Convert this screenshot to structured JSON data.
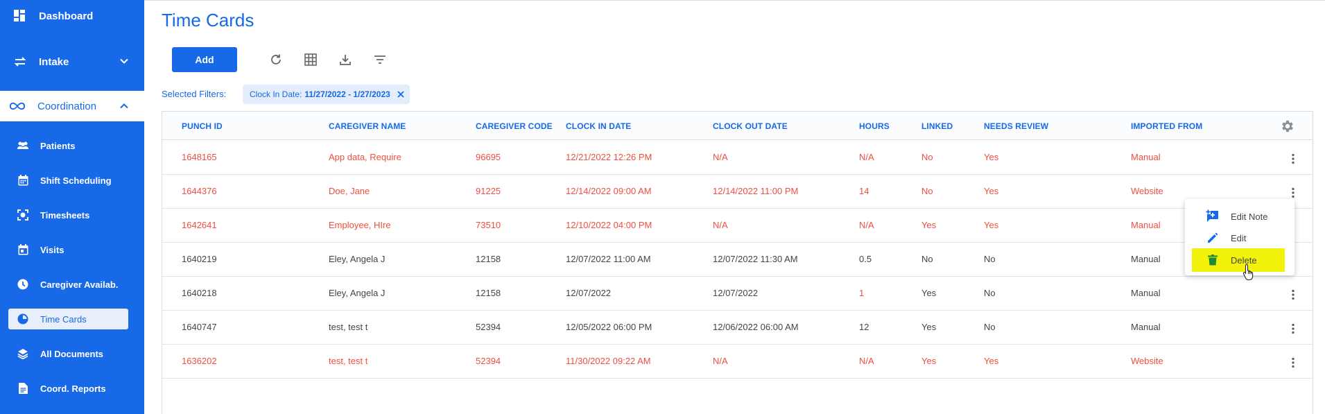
{
  "sidebar": {
    "dashboard": "Dashboard",
    "intake": "Intake",
    "coordination": "Coordination",
    "items": [
      {
        "label": "Patients",
        "icon": "people-icon"
      },
      {
        "label": "Shift Scheduling",
        "icon": "calendar-icon"
      },
      {
        "label": "Timesheets",
        "icon": "scan-icon"
      },
      {
        "label": "Visits",
        "icon": "calendar-check-icon"
      },
      {
        "label": "Caregiver Availab.",
        "icon": "clock-icon"
      },
      {
        "label": "Time Cards",
        "icon": "timer-icon",
        "active": true
      },
      {
        "label": "All Documents",
        "icon": "layers-icon"
      },
      {
        "label": "Coord. Reports",
        "icon": "document-icon"
      }
    ]
  },
  "page": {
    "title": "Time Cards",
    "add_label": "Add",
    "filters_label": "Selected Filters:",
    "filter_chip": {
      "key": "Clock In Date:",
      "value": "11/27/2022 - 1/27/2023"
    }
  },
  "table": {
    "columns": [
      "PUNCH ID",
      "CAREGIVER NAME",
      "CAREGIVER CODE",
      "CLOCK IN DATE",
      "CLOCK OUT DATE",
      "HOURS",
      "LINKED",
      "NEEDS REVIEW",
      "IMPORTED FROM"
    ],
    "rows": [
      {
        "id": "1648165",
        "name": "App data, Require",
        "code": "96695",
        "in": "12/21/2022 12:26 PM",
        "out": "N/A",
        "hours": "N/A",
        "linked": "No",
        "review": "Yes",
        "source": "Manual",
        "flag": true
      },
      {
        "id": "1644376",
        "name": "Doe, Jane",
        "code": "91225",
        "in": "12/14/2022 09:00 AM",
        "out": "12/14/2022 11:00 PM",
        "hours": "14",
        "linked": "No",
        "review": "Yes",
        "source": "Website",
        "flag": true
      },
      {
        "id": "1642641",
        "name": "Employee, HIre",
        "code": "73510",
        "in": "12/10/2022 04:00 PM",
        "out": "N/A",
        "hours": "N/A",
        "linked": "Yes",
        "review": "Yes",
        "source": "Manual",
        "flag": true
      },
      {
        "id": "1640219",
        "name": "Eley, Angela J",
        "code": "12158",
        "in": "12/07/2022 11:00 AM",
        "out": "12/07/2022 11:30 AM",
        "hours": "0.5",
        "linked": "No",
        "review": "No",
        "source": "Manual",
        "flag": false
      },
      {
        "id": "1640218",
        "name": "Eley, Angela J",
        "code": "12158",
        "in": "12/07/2022",
        "out": "12/07/2022",
        "hours": "1",
        "linked": "Yes",
        "review": "No",
        "source": "Manual",
        "flag": false,
        "hours_flag": true
      },
      {
        "id": "1640747",
        "name": "test, test t",
        "code": "52394",
        "in": "12/05/2022 06:00 PM",
        "out": "12/06/2022 06:00 AM",
        "hours": "12",
        "linked": "Yes",
        "review": "No",
        "source": "Manual",
        "flag": false
      },
      {
        "id": "1636202",
        "name": "test, test t",
        "code": "52394",
        "in": "11/30/2022 09:22 AM",
        "out": "N/A",
        "hours": "N/A",
        "linked": "Yes",
        "review": "Yes",
        "source": "Website",
        "flag": true
      }
    ]
  },
  "context_menu": {
    "items": [
      "Edit Note",
      "Edit",
      "Delete"
    ],
    "highlighted": "Delete"
  },
  "colors": {
    "brand": "#1769e8",
    "warning_text": "#f04e3e",
    "highlight": "#f2f20a"
  }
}
